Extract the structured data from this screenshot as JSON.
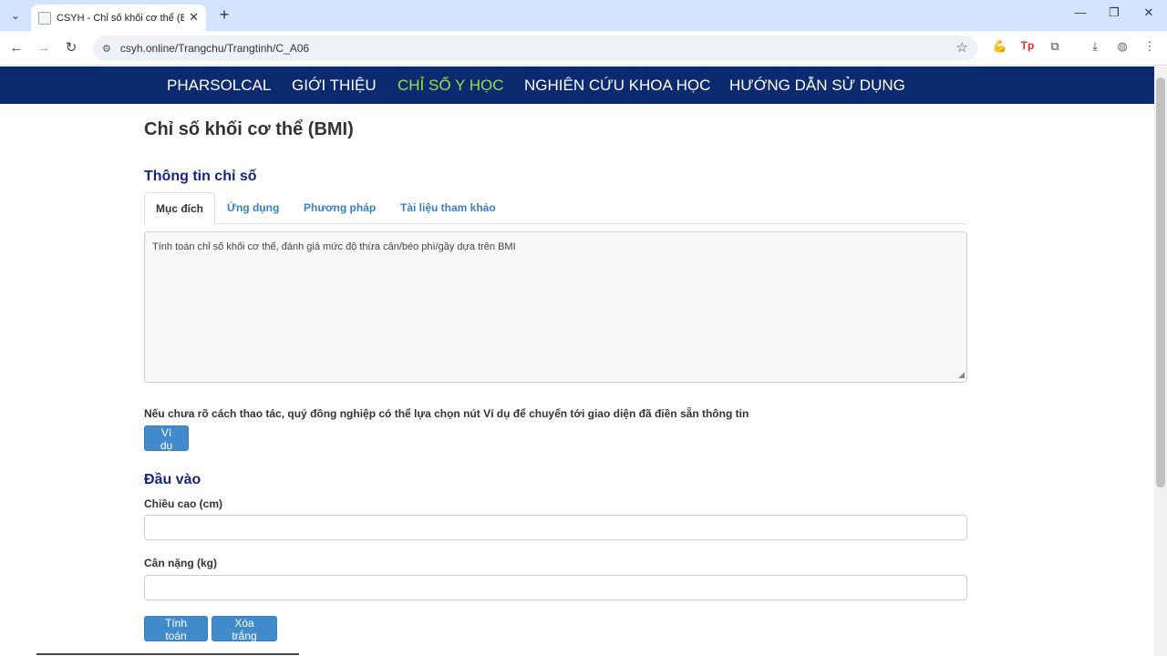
{
  "browser": {
    "tab_title": "CSYH - Chỉ số khối cơ thể (BMI)",
    "url": "csyh.online/Trangchu/Trangtinh/C_A06",
    "icons": {
      "tab_search": "chevron-down-icon",
      "close": "close-icon",
      "new_tab": "plus-icon",
      "back": "back-arrow-icon",
      "forward": "forward-arrow-icon",
      "reload": "reload-icon",
      "site_info": "site-info-icon",
      "bookmark": "star-icon",
      "extensions": "puzzle-icon",
      "download": "download-icon",
      "profile": "profile-icon",
      "menu": "kebab-menu-icon"
    }
  },
  "sitenav": {
    "items": [
      {
        "label": "PHARSOLCAL",
        "active": false
      },
      {
        "label": "GIỚI THIỆU",
        "active": false
      },
      {
        "label": "CHỈ SỐ Y HỌC",
        "active": true
      },
      {
        "label": "NGHIÊN CỨU KHOA HỌC",
        "active": false
      },
      {
        "label": "HƯỚNG DẪN SỬ DỤNG",
        "active": false
      }
    ],
    "colors": {
      "background": "#0b2a6f",
      "active": "#9be04a"
    }
  },
  "page": {
    "title": "Chỉ số khối cơ thể (BMI)",
    "info_section_title": "Thông tin chỉ số",
    "tabs": [
      {
        "label": "Mục đích",
        "active": true
      },
      {
        "label": "Ứng dụng",
        "active": false
      },
      {
        "label": "Phương pháp",
        "active": false
      },
      {
        "label": "Tài liệu tham khảo",
        "active": false
      }
    ],
    "description": "Tính toán chỉ số khối cơ thể, đánh giá mức độ thừa cân/béo phì/gầy dựa trên BMI",
    "hint": "Nếu chưa rõ cách thao tác, quý đồng nghiệp có thể lựa chọn nút Ví dụ để chuyển tới giao diện đã điền sẵn thông tin",
    "example_button": "Ví dụ",
    "input_section_title": "Đầu vào",
    "height_label": "Chiều cao (cm)",
    "height_value": "",
    "weight_label": "Cân nặng (kg)",
    "weight_value": "",
    "calculate_button": "Tính toán",
    "clear_button": "Xóa trắng"
  }
}
